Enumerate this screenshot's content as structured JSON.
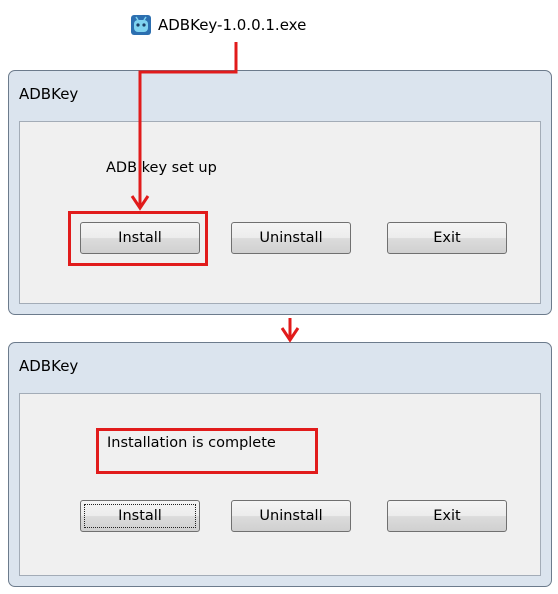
{
  "exe_file": {
    "name": "ADBKey-1.0.0.1.exe",
    "icon": "app-icon"
  },
  "dialog_before": {
    "title": "ADBKey",
    "message": "ADB key set up",
    "buttons": {
      "install": "Install",
      "uninstall": "Uninstall",
      "exit": "Exit"
    }
  },
  "dialog_after": {
    "title": "ADBKey",
    "message": "Installation is complete",
    "buttons": {
      "install": "Install",
      "uninstall": "Uninstall",
      "exit": "Exit"
    }
  },
  "colors": {
    "highlight": "#e11b1b",
    "frame": "#dbe4ee",
    "client": "#f0f0f0"
  }
}
